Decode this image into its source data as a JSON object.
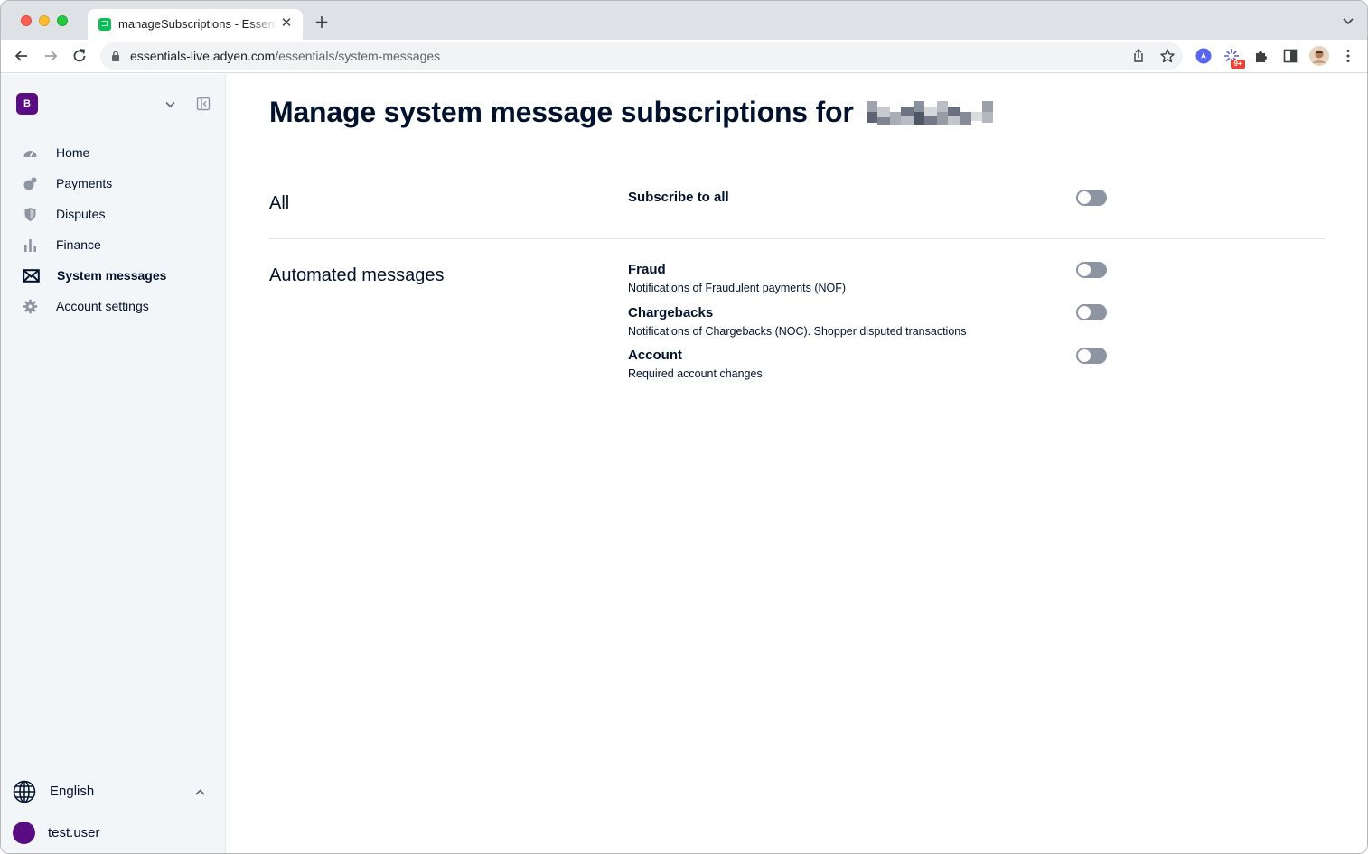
{
  "browser": {
    "tab_title": "manageSubscriptions - Essentials",
    "url_domain": "essentials-live.adyen.com",
    "url_path": "/essentials/system-messages",
    "extension_badge": "9+"
  },
  "sidebar": {
    "org_initial": "B",
    "items": [
      {
        "label": "Home",
        "icon": "gauge-icon"
      },
      {
        "label": "Payments",
        "icon": "payments-icon"
      },
      {
        "label": "Disputes",
        "icon": "shield-icon"
      },
      {
        "label": "Finance",
        "icon": "bar-chart-icon"
      },
      {
        "label": "System messages",
        "icon": "envelope-icon",
        "active": true
      },
      {
        "label": "Account settings",
        "icon": "gear-icon"
      }
    ],
    "language": "English",
    "user": "test.user"
  },
  "main": {
    "title": "Manage system message subscriptions for",
    "sections": [
      {
        "label": "All",
        "items": [
          {
            "title": "Subscribe to all",
            "description": "",
            "enabled": false
          }
        ]
      },
      {
        "label": "Automated messages",
        "items": [
          {
            "title": "Fraud",
            "description": "Notifications of Fraudulent payments (NOF)",
            "enabled": false
          },
          {
            "title": "Chargebacks",
            "description": "Notifications of Chargebacks (NOC). Shopper disputed transactions",
            "enabled": false
          },
          {
            "title": "Account",
            "description": "Required account changes",
            "enabled": false
          }
        ]
      }
    ]
  },
  "colors": {
    "accent": "#5a0d82",
    "text": "#00112c",
    "toggle_off": "#8d95a3"
  }
}
